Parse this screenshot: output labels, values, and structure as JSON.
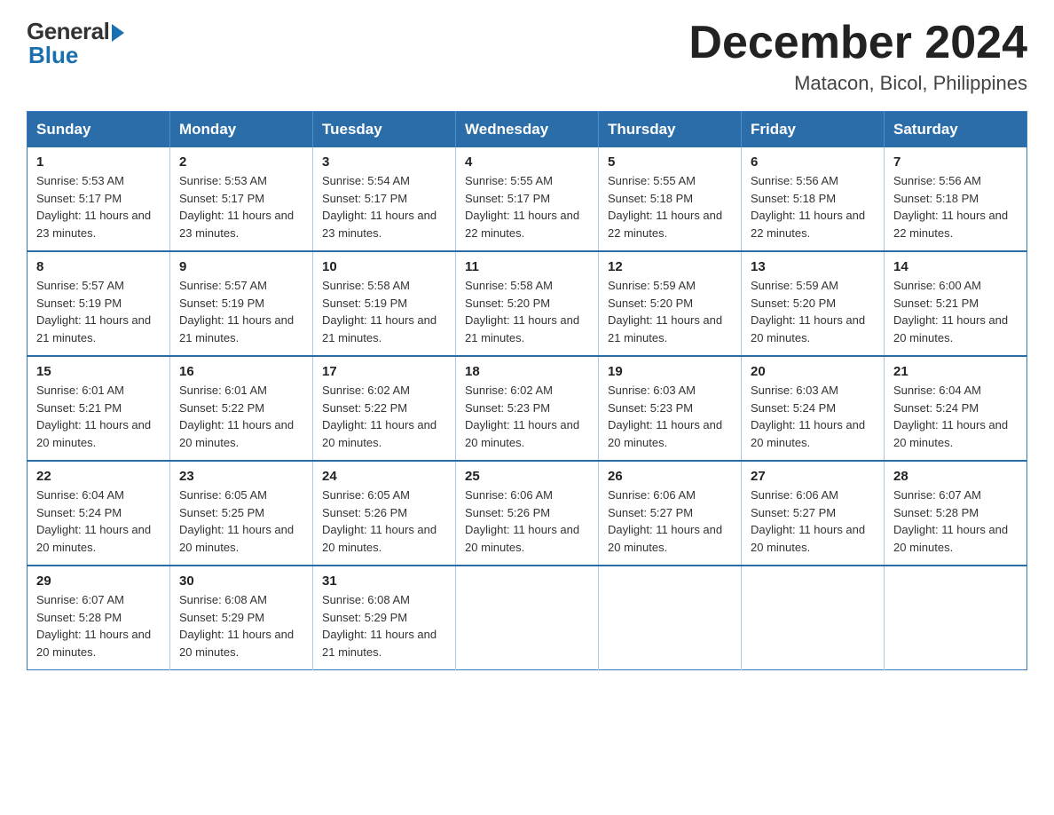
{
  "logo": {
    "general": "General",
    "blue": "Blue"
  },
  "title": {
    "main": "December 2024",
    "sub": "Matacon, Bicol, Philippines"
  },
  "weekdays": [
    "Sunday",
    "Monday",
    "Tuesday",
    "Wednesday",
    "Thursday",
    "Friday",
    "Saturday"
  ],
  "weeks": [
    [
      {
        "day": 1,
        "sunrise": "5:53 AM",
        "sunset": "5:17 PM",
        "daylight": "11 hours and 23 minutes."
      },
      {
        "day": 2,
        "sunrise": "5:53 AM",
        "sunset": "5:17 PM",
        "daylight": "11 hours and 23 minutes."
      },
      {
        "day": 3,
        "sunrise": "5:54 AM",
        "sunset": "5:17 PM",
        "daylight": "11 hours and 23 minutes."
      },
      {
        "day": 4,
        "sunrise": "5:55 AM",
        "sunset": "5:17 PM",
        "daylight": "11 hours and 22 minutes."
      },
      {
        "day": 5,
        "sunrise": "5:55 AM",
        "sunset": "5:18 PM",
        "daylight": "11 hours and 22 minutes."
      },
      {
        "day": 6,
        "sunrise": "5:56 AM",
        "sunset": "5:18 PM",
        "daylight": "11 hours and 22 minutes."
      },
      {
        "day": 7,
        "sunrise": "5:56 AM",
        "sunset": "5:18 PM",
        "daylight": "11 hours and 22 minutes."
      }
    ],
    [
      {
        "day": 8,
        "sunrise": "5:57 AM",
        "sunset": "5:19 PM",
        "daylight": "11 hours and 21 minutes."
      },
      {
        "day": 9,
        "sunrise": "5:57 AM",
        "sunset": "5:19 PM",
        "daylight": "11 hours and 21 minutes."
      },
      {
        "day": 10,
        "sunrise": "5:58 AM",
        "sunset": "5:19 PM",
        "daylight": "11 hours and 21 minutes."
      },
      {
        "day": 11,
        "sunrise": "5:58 AM",
        "sunset": "5:20 PM",
        "daylight": "11 hours and 21 minutes."
      },
      {
        "day": 12,
        "sunrise": "5:59 AM",
        "sunset": "5:20 PM",
        "daylight": "11 hours and 21 minutes."
      },
      {
        "day": 13,
        "sunrise": "5:59 AM",
        "sunset": "5:20 PM",
        "daylight": "11 hours and 20 minutes."
      },
      {
        "day": 14,
        "sunrise": "6:00 AM",
        "sunset": "5:21 PM",
        "daylight": "11 hours and 20 minutes."
      }
    ],
    [
      {
        "day": 15,
        "sunrise": "6:01 AM",
        "sunset": "5:21 PM",
        "daylight": "11 hours and 20 minutes."
      },
      {
        "day": 16,
        "sunrise": "6:01 AM",
        "sunset": "5:22 PM",
        "daylight": "11 hours and 20 minutes."
      },
      {
        "day": 17,
        "sunrise": "6:02 AM",
        "sunset": "5:22 PM",
        "daylight": "11 hours and 20 minutes."
      },
      {
        "day": 18,
        "sunrise": "6:02 AM",
        "sunset": "5:23 PM",
        "daylight": "11 hours and 20 minutes."
      },
      {
        "day": 19,
        "sunrise": "6:03 AM",
        "sunset": "5:23 PM",
        "daylight": "11 hours and 20 minutes."
      },
      {
        "day": 20,
        "sunrise": "6:03 AM",
        "sunset": "5:24 PM",
        "daylight": "11 hours and 20 minutes."
      },
      {
        "day": 21,
        "sunrise": "6:04 AM",
        "sunset": "5:24 PM",
        "daylight": "11 hours and 20 minutes."
      }
    ],
    [
      {
        "day": 22,
        "sunrise": "6:04 AM",
        "sunset": "5:24 PM",
        "daylight": "11 hours and 20 minutes."
      },
      {
        "day": 23,
        "sunrise": "6:05 AM",
        "sunset": "5:25 PM",
        "daylight": "11 hours and 20 minutes."
      },
      {
        "day": 24,
        "sunrise": "6:05 AM",
        "sunset": "5:26 PM",
        "daylight": "11 hours and 20 minutes."
      },
      {
        "day": 25,
        "sunrise": "6:06 AM",
        "sunset": "5:26 PM",
        "daylight": "11 hours and 20 minutes."
      },
      {
        "day": 26,
        "sunrise": "6:06 AM",
        "sunset": "5:27 PM",
        "daylight": "11 hours and 20 minutes."
      },
      {
        "day": 27,
        "sunrise": "6:06 AM",
        "sunset": "5:27 PM",
        "daylight": "11 hours and 20 minutes."
      },
      {
        "day": 28,
        "sunrise": "6:07 AM",
        "sunset": "5:28 PM",
        "daylight": "11 hours and 20 minutes."
      }
    ],
    [
      {
        "day": 29,
        "sunrise": "6:07 AM",
        "sunset": "5:28 PM",
        "daylight": "11 hours and 20 minutes."
      },
      {
        "day": 30,
        "sunrise": "6:08 AM",
        "sunset": "5:29 PM",
        "daylight": "11 hours and 20 minutes."
      },
      {
        "day": 31,
        "sunrise": "6:08 AM",
        "sunset": "5:29 PM",
        "daylight": "11 hours and 21 minutes."
      },
      null,
      null,
      null,
      null
    ]
  ]
}
